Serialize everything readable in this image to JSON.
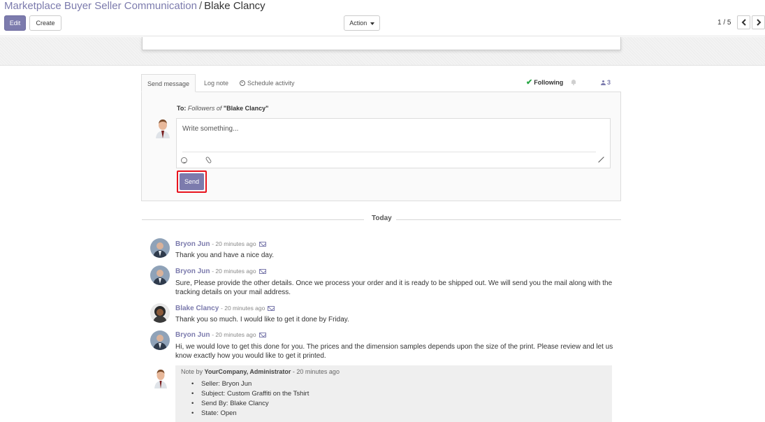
{
  "breadcrumb": {
    "parent": "Marketplace Buyer Seller Communication",
    "separator": "/",
    "current": "Blake Clancy"
  },
  "toolbar": {
    "edit_label": "Edit",
    "create_label": "Create",
    "action_label": "Action"
  },
  "pager": {
    "value": "1 / 5"
  },
  "chatter": {
    "tabs": {
      "send_message": "Send message",
      "log_note": "Log note",
      "schedule_activity": "Schedule activity"
    },
    "following_label": "Following",
    "followers_count": "3",
    "to_prefix": "To:",
    "to_followers_of": "Followers of",
    "to_record": "\"Blake Clancy\"",
    "placeholder": "Write something...",
    "send_label": "Send",
    "separator_label": "Today"
  },
  "messages": [
    {
      "author": "Bryon Jun",
      "time": "- 20 minutes ago",
      "body": "Thank you and have a nice day."
    },
    {
      "author": "Bryon Jun",
      "time": "- 20 minutes ago",
      "body": "Sure, Please provide the other details. Once we process your order and it is ready to be shipped out. We will send you the mail along with the tracking details on your mail address."
    },
    {
      "author": "Blake Clancy",
      "time": "- 20 minutes ago",
      "body": "Thank you so much. I would like to get it done by Friday."
    },
    {
      "author": "Bryon Jun",
      "time": "- 20 minutes ago",
      "body": "Hi, we would love to get this done for you. The prices and the dimension samples depends upon the size of the print. Please review and let us know exactly how you would like to get it printed."
    }
  ],
  "note": {
    "prefix": "Note by",
    "author": "YourCompany, Administrator",
    "time": "- 20 minutes ago",
    "items": [
      "Seller: Bryon Jun",
      "Subject: Custom Graffiti on the Tshirt",
      "Send By: Blake Clancy",
      "State: Open"
    ]
  },
  "colors": {
    "brand": "#7c7bad",
    "highlight": "#e8131d",
    "following_check": "#28a745"
  },
  "icons": [
    "caret-down-icon",
    "chevron-left-icon",
    "chevron-right-icon",
    "clock-icon",
    "check-icon",
    "bell-icon",
    "user-icon",
    "emoji-icon",
    "paperclip-icon",
    "expand-icon",
    "mail-icon"
  ]
}
